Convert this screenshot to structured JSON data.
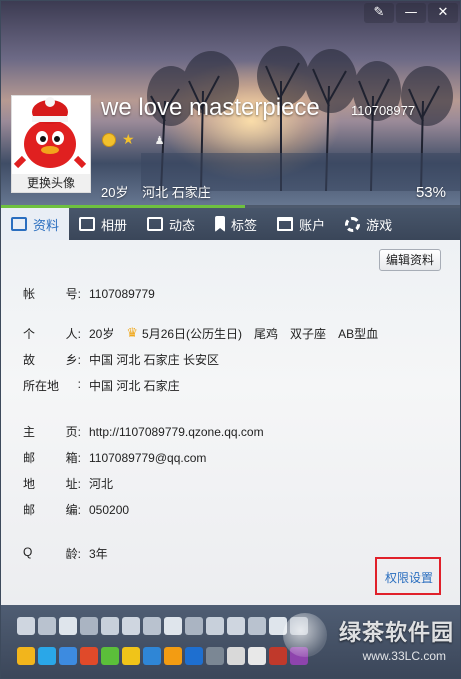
{
  "window": {
    "controls": [
      "✎",
      "—",
      "✕"
    ]
  },
  "profile": {
    "nickname": "we love masterpiece",
    "qq_number": "110708977",
    "avatar_caption": "更换头像",
    "age": "20岁",
    "location": "河北 石家庄",
    "level_percent_label": "53%",
    "level_percent": 53
  },
  "tabs": [
    {
      "label": "资料",
      "icon": "profile-card-icon",
      "active": true
    },
    {
      "label": "相册",
      "icon": "photo-icon",
      "active": false
    },
    {
      "label": "动态",
      "icon": "feed-icon",
      "active": false
    },
    {
      "label": "标签",
      "icon": "bookmark-icon",
      "active": false
    },
    {
      "label": "账户",
      "icon": "wallet-icon",
      "active": false
    },
    {
      "label": "游戏",
      "icon": "gear-icon",
      "active": false
    }
  ],
  "toolbar": {
    "edit_label": "编辑资料"
  },
  "info": {
    "account": {
      "label_a": "帐",
      "label_b": "号:",
      "value": "1107089779"
    },
    "personal": {
      "label_a": "个",
      "label_b": "人:",
      "age": "20岁",
      "birthday": "5月26日(公历生日)",
      "zodiac": "尾鸡",
      "constellation": "双子座",
      "blood": "AB型血"
    },
    "hometown": {
      "label_a": "故",
      "label_b": "乡:",
      "value": "中国 河北 石家庄 长安区"
    },
    "residence": {
      "label_a": "所在地",
      "label_b": ":",
      "value": "中国 河北 石家庄"
    },
    "homepage": {
      "label_a": "主",
      "label_b": "页:",
      "value": "http://1107089779.qzone.qq.com"
    },
    "email": {
      "label_a": "邮",
      "label_b": "箱:",
      "value": "1107089779@qq.com"
    },
    "address": {
      "label_a": "地",
      "label_b": "址:",
      "value": "河北"
    },
    "zipcode": {
      "label_a": "邮",
      "label_b": "编:",
      "value": "050200"
    },
    "qq_age": {
      "label_a": "Q",
      "label_b": "龄:",
      "value": "3年"
    }
  },
  "permission_link": "权限设置",
  "watermark": {
    "title": "绿茶软件园",
    "url": "www.33LC.com"
  },
  "colors": {
    "accent": "#2a6ebf",
    "progress": "#6ec13f",
    "highlight_box": "#e0202a"
  }
}
